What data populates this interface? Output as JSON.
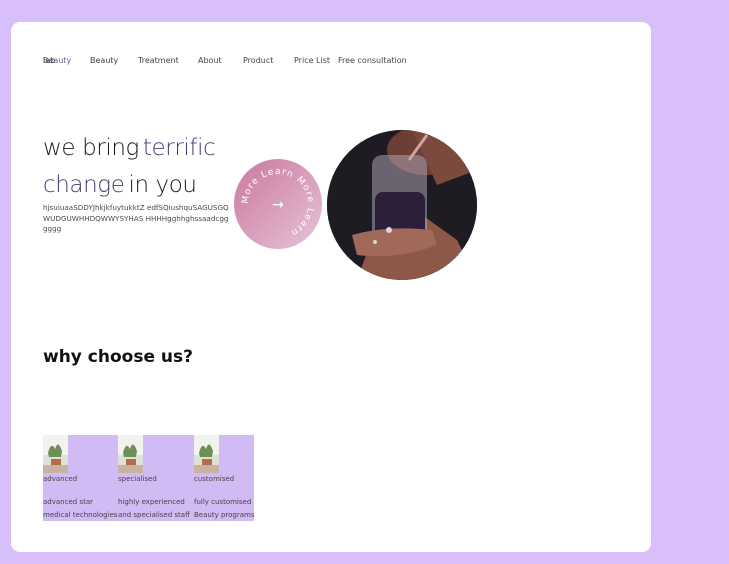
{
  "nav": {
    "brand_prefix": "Beauty",
    "brand_suffix": "lab",
    "items": [
      {
        "label": "Beauty"
      },
      {
        "label": "Treatment"
      },
      {
        "label": "About"
      },
      {
        "label": "Product"
      },
      {
        "label": "Price List"
      },
      {
        "label": "Free consultation"
      }
    ]
  },
  "hero": {
    "line1_a": "we bring",
    "line1_b": "terrific",
    "line2_a": "change",
    "line2_b": "in you",
    "subtext": "hjsuiuaaSDDYJhkjkfuytukktZ edfSQiushquSAGUSGQWUDGUWHHDQWWYSYHAS HHHHgghhghssaadcgggggg",
    "badge_text": "More Learn More Learn ",
    "badge_arrow": "→"
  },
  "section": {
    "title": "why choose us?"
  },
  "features": [
    {
      "label": "advanced",
      "line1": "advanced star",
      "line2": "medical technologies"
    },
    {
      "label": "specialised",
      "line1": "highly experienced",
      "line2": "and specialised staff"
    },
    {
      "label": "customised",
      "line1": "fully customised",
      "line2": "Beauty programs"
    }
  ],
  "colors": {
    "background": "#d9bff9",
    "card": "#ffffff",
    "accent": "#4a3a72",
    "feature_bg": "#d2baf5"
  }
}
